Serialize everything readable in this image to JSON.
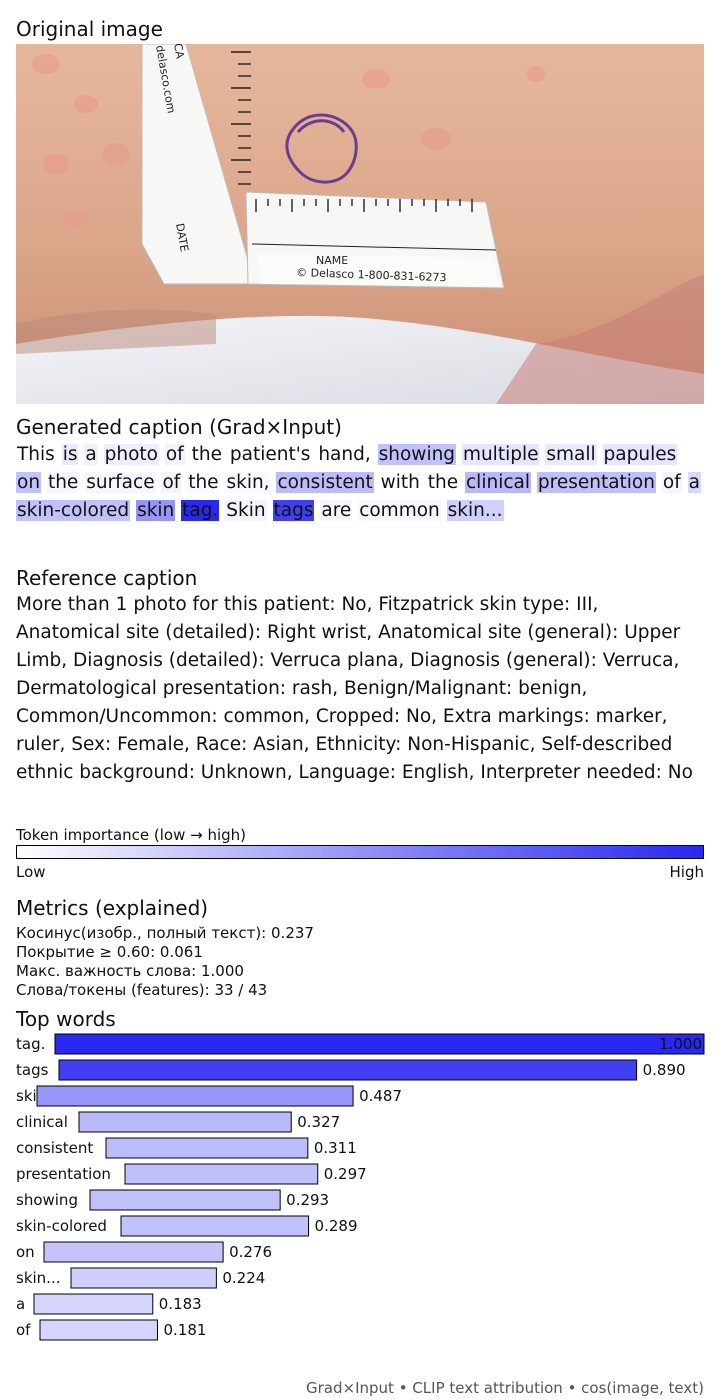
{
  "sections": {
    "original_image": "Original image",
    "generated_caption": "Generated caption (Grad×Input)",
    "reference_caption": "Reference caption",
    "metrics": "Metrics (explained)",
    "top_words": "Top words"
  },
  "photo": {
    "ruler_text_1": "DATE",
    "ruler_text_2": "NAME",
    "ruler_text_3": "© Delasco 1-800-831-6273",
    "ruler_text_4": "delasco.com",
    "ruler_text_5": "CA"
  },
  "caption_tokens": [
    {
      "t": "This",
      "w": 0
    },
    {
      "t": "is",
      "w": 0.1
    },
    {
      "t": "a",
      "w": 0.07
    },
    {
      "t": "photo",
      "w": 0.08
    },
    {
      "t": "of",
      "w": 0.06
    },
    {
      "t": "the",
      "w": 0
    },
    {
      "t": "patient's",
      "w": 0
    },
    {
      "t": "hand,",
      "w": 0
    },
    {
      "t": "showing",
      "w": 0.29
    },
    {
      "t": "multiple",
      "w": 0.12
    },
    {
      "t": "small",
      "w": 0.1
    },
    {
      "t": "papules",
      "w": 0.12
    },
    {
      "t": "on",
      "w": 0.28
    },
    {
      "t": "the",
      "w": 0.04
    },
    {
      "t": "surface",
      "w": 0.04
    },
    {
      "t": "of",
      "w": 0.05
    },
    {
      "t": "the",
      "w": 0.03
    },
    {
      "t": "skin,",
      "w": 0.03
    },
    {
      "t": "consistent",
      "w": 0.31
    },
    {
      "t": "with",
      "w": 0
    },
    {
      "t": "the",
      "w": 0
    },
    {
      "t": "clinical",
      "w": 0.33
    },
    {
      "t": "presentation",
      "w": 0.3
    },
    {
      "t": "of",
      "w": 0.05
    },
    {
      "t": "a",
      "w": 0.18
    },
    {
      "t": "skin-colored",
      "w": 0.29
    },
    {
      "t": "skin",
      "w": 0.49
    },
    {
      "t": "tag.",
      "w": 1.0
    },
    {
      "t": "Skin",
      "w": 0.05
    },
    {
      "t": "tags",
      "w": 0.89
    },
    {
      "t": "are",
      "w": 0.04
    },
    {
      "t": "common",
      "w": 0.04
    },
    {
      "t": "skin...",
      "w": 0.22
    }
  ],
  "reference_text": "More than 1 photo for this patient: No, Fitzpatrick skin type: III, Anatomical site (detailed): Right wrist, Anatomical site (general): Upper Limb, Diagnosis (detailed): Verruca plana, Diagnosis (general): Verruca, Dermatological presentation: rash, Benign/Malignant: benign, Common/Uncommon: common, Cropped: No, Extra markings: marker, ruler, Sex: Female, Race: Asian, Ethnicity: Non-Hispanic, Self-described ethnic background: Unknown, Language: English, Interpreter needed: No",
  "colorbar": {
    "title": "Token importance (low → high)",
    "low": "Low",
    "high": "High",
    "color_low": "#ffffff",
    "color_high": "#2828f0"
  },
  "metrics": {
    "line1": "Косинус(изобр., полный текст): 0.237",
    "line2": "Покрытие ≥ 0.60: 0.061",
    "line3": "Макс. важность слова: 1.000",
    "line4": "Слова/токены (features): 33 / 43"
  },
  "chart_data": {
    "type": "bar",
    "orientation": "horizontal",
    "title": "Top words",
    "categories": [
      "tag.",
      "tags",
      "skin",
      "clinical",
      "consistent",
      "presentation",
      "showing",
      "skin-colored",
      "on",
      "skin...",
      "a",
      "of"
    ],
    "values": [
      1.0,
      0.89,
      0.487,
      0.327,
      0.311,
      0.297,
      0.293,
      0.289,
      0.276,
      0.224,
      0.183,
      0.181
    ],
    "value_labels": [
      "1.000",
      "0.890",
      "0.487",
      "0.327",
      "0.311",
      "0.297",
      "0.293",
      "0.289",
      "0.276",
      "0.224",
      "0.183",
      "0.181"
    ],
    "xlim": [
      0,
      1
    ],
    "bar_color_low": "#ffffff",
    "bar_color_high": "#2828f0"
  },
  "footer": "Grad×Input • CLIP text attribution • cos(image, text)"
}
